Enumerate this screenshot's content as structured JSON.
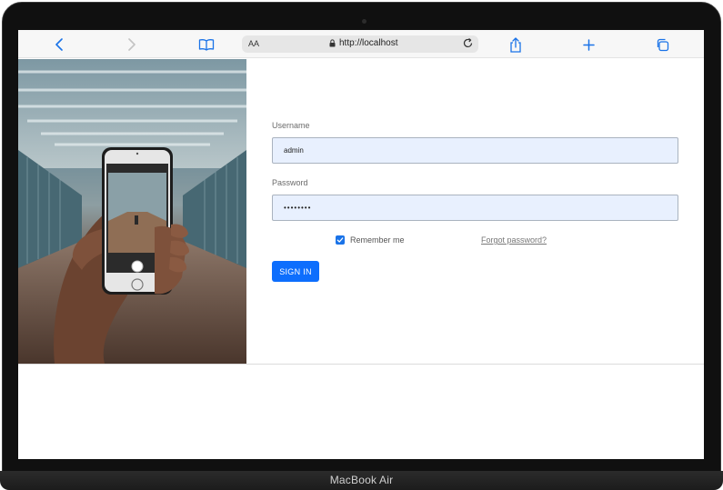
{
  "device": {
    "model_label": "MacBook Air"
  },
  "browser": {
    "back_icon": "chevron-left-icon",
    "forward_icon": "chevron-right-icon",
    "bookmarks_icon": "book-icon",
    "text_size_label": "AA",
    "lock_icon": "lock-icon",
    "url": "http://localhost",
    "reload_icon": "reload-icon",
    "share_icon": "share-icon",
    "new_tab_icon": "plus-icon",
    "tabs_icon": "tabs-icon",
    "accent_color": "#1a73e8"
  },
  "login": {
    "username_label": "Username",
    "username_value": "admin",
    "password_label": "Password",
    "password_value": "••••••••",
    "remember_label": "Remember me",
    "remember_checked": true,
    "forgot_link": "Forgot password?",
    "submit_label": "SIGN IN",
    "submit_color": "#0d6efd",
    "field_background": "#e8f0fe"
  }
}
